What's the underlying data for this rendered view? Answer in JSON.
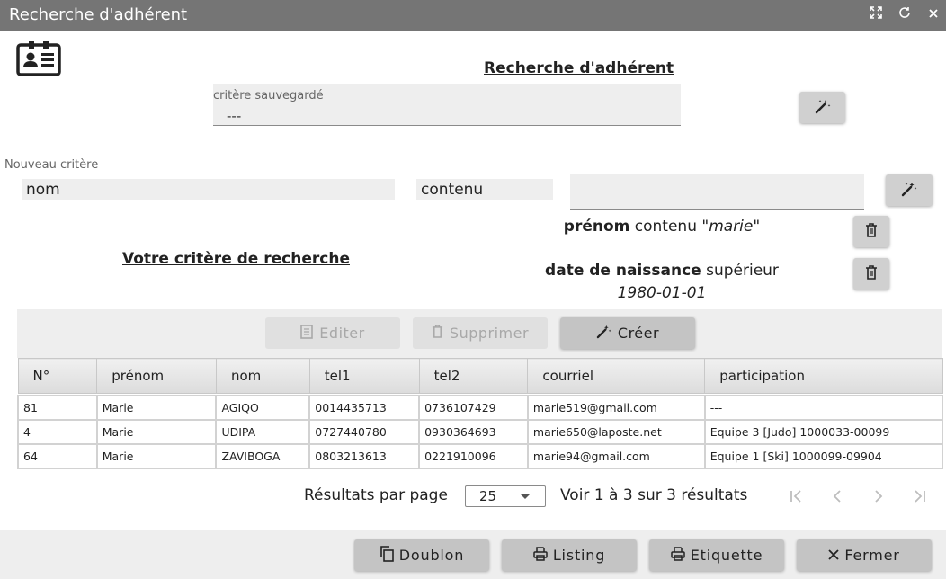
{
  "window": {
    "title": "Recherche d'adhérent"
  },
  "header": {
    "title": "Recherche d'adhérent"
  },
  "saved_criteria": {
    "label": "critère sauvegardé",
    "value": "---"
  },
  "new_criteria": {
    "label": "Nouveau critère",
    "field": "nom",
    "operator": "contenu",
    "value": ""
  },
  "your_criteria": {
    "title": "Votre critère de recherche",
    "items": [
      {
        "field": "prénom",
        "operator": "contenu",
        "value": "\"marie\""
      },
      {
        "field": "date de naissance",
        "operator": "supérieur",
        "value": "1980-01-01"
      }
    ]
  },
  "toolbar": {
    "edit_label": "Editer",
    "delete_label": "Supprimer",
    "create_label": "Créer"
  },
  "table": {
    "columns": [
      "N°",
      "prénom",
      "nom",
      "tel1",
      "tel2",
      "courriel",
      "participation"
    ],
    "rows": [
      [
        "81",
        "Marie",
        "AGIQO",
        "0014435713",
        "0736107429",
        "marie519@gmail.com",
        "---"
      ],
      [
        "4",
        "Marie",
        "UDIPA",
        "0727440780",
        "0930364693",
        "marie650@laposte.net",
        "Equipe 3 [Judo] 1000033-00099"
      ],
      [
        "64",
        "Marie",
        "ZAVIBOGA",
        "0803213613",
        "0221910096",
        "marie94@gmail.com",
        "Equipe 1 [Ski] 1000099-09904"
      ]
    ]
  },
  "pagination": {
    "per_page_label": "Résultats par page",
    "per_page_value": "25",
    "range_text": "Voir 1 à 3 sur 3 résultats"
  },
  "footer": {
    "duplicate_label": "Doublon",
    "listing_label": "Listing",
    "label_label": "Etiquette",
    "close_label": "Fermer"
  }
}
